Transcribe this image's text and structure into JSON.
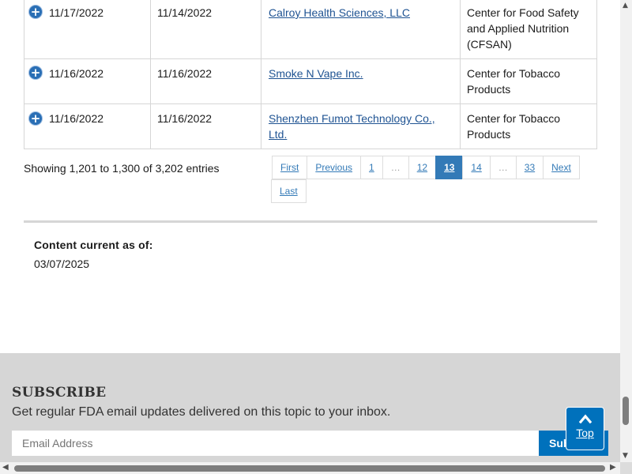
{
  "table": {
    "rows": [
      {
        "col1": "11/17/2022",
        "col2": "11/14/2022",
        "company": "Calroy Health Sciences, LLC",
        "center": [
          "Center for Food Safety",
          "and Applied Nutrition",
          "(CFSAN)"
        ]
      },
      {
        "col1": "11/16/2022",
        "col2": "11/16/2022",
        "company": "Smoke N Vape Inc.",
        "center": [
          "Center for Tobacco",
          "Products"
        ]
      },
      {
        "col1": "11/16/2022",
        "col2": "11/16/2022",
        "company_lines": [
          "Shenzhen Fumot Technology Co.,",
          "Ltd."
        ],
        "center": [
          "Center for Tobacco",
          "Products"
        ]
      }
    ],
    "expand_glyph": "+"
  },
  "pagination": {
    "info": "Showing 1,201 to 1,300 of 3,202 entries",
    "first": "First",
    "previous": "Previous",
    "p1": "1",
    "ellipsis1": "…",
    "p12": "12",
    "current": "13",
    "p14": "14",
    "ellipsis2": "…",
    "p33": "33",
    "next": "Next",
    "last": "Last"
  },
  "content_current": {
    "label": "Content current as of:",
    "date": "03/07/2025"
  },
  "subscribe": {
    "title": "SUBSCRIBE",
    "description": "Get regular FDA email updates delivered on this topic to your inbox.",
    "email_placeholder": "Email Address",
    "button_label": "Subscribe"
  },
  "back_to_top": {
    "icon": "chevron-up-icon",
    "glyph": "⌃",
    "label": "Top"
  },
  "colors": {
    "link": "#205493",
    "pager_active": "#337ab7",
    "subscribe_band": "#d6d6d6",
    "primary_button": "#0071bc"
  }
}
